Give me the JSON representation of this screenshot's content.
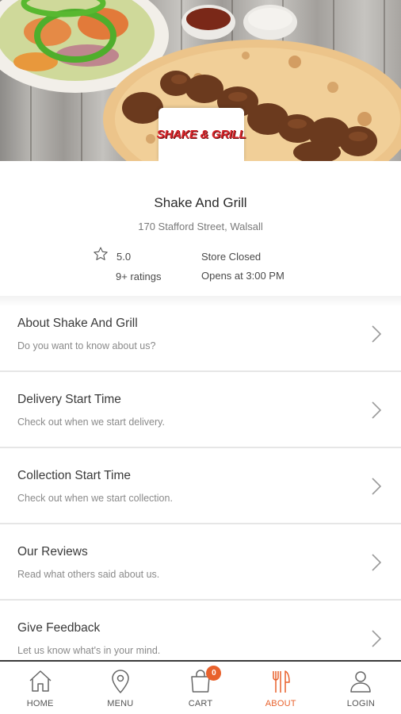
{
  "hero": {
    "image_description_icon": "food-banner-image",
    "logo_text": "SHAKE & GRILL"
  },
  "store": {
    "name": "Shake And Grill",
    "address": "170 Stafford Street, Walsall",
    "rating": "5.0",
    "rating_count": "9+ ratings",
    "status": "Store Closed",
    "opens": "Opens at 3:00 PM"
  },
  "menu": {
    "items": [
      {
        "title": "About Shake And Grill",
        "subtitle": "Do you want to know about us?"
      },
      {
        "title": "Delivery Start Time",
        "subtitle": "Check out when we start delivery."
      },
      {
        "title": "Collection Start Time",
        "subtitle": "Check out when we start collection."
      },
      {
        "title": "Our Reviews",
        "subtitle": "Read what others said about us."
      },
      {
        "title": "Give Feedback",
        "subtitle": "Let us know what's in your mind."
      }
    ]
  },
  "nav": {
    "home": "HOME",
    "menu": "MENU",
    "cart": "CART",
    "cart_count": "0",
    "about": "ABOUT",
    "login": "LOGIN",
    "active": "about"
  },
  "colors": {
    "accent": "#e8612c",
    "logo_red": "#d9262c"
  }
}
